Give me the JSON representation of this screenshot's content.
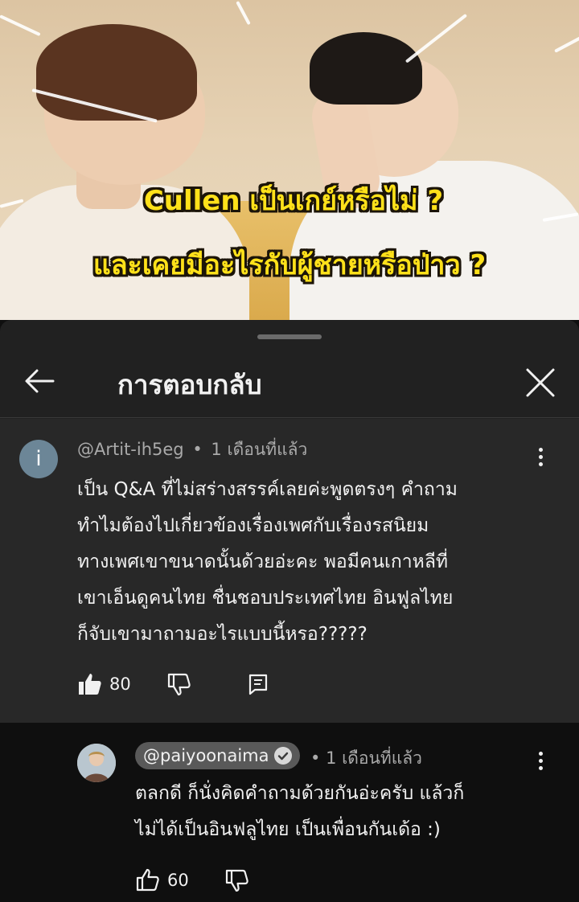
{
  "video": {
    "caption_line1": "Cullen เป็นเกย์หรือไม่ ?",
    "caption_line2": "และเคยมีอะไรกับผู้ชายหรือป่าว ?"
  },
  "sheet": {
    "title": "การตอบกลับ"
  },
  "comment": {
    "author": "@Artit-ih5eg",
    "separator": "•",
    "time": "1 เดือนที่แล้ว",
    "avatar_letter": "i",
    "lines": [
      "เป็น Q&A ที่ไม่สร่างสรรค์เลยค่ะพูดตรงๆ คำถาม",
      "ทำไมต้องไปเกี่ยวข้องเรื่องเพศกับเรื่องรสนิยม",
      "ทางเพศเขาขนาดนั้นด้วยอ่ะคะ พอมีคนเกาหลีที่",
      "เขาเอ็นดูคนไทย ชื่นชอบประเทศไทย อินฟูลไทย",
      "ก็จับเขามาถามอะไรแบบนี้หรอ?????"
    ],
    "likes": "80"
  },
  "reply": {
    "author": "@paiyoonaima",
    "separator": "•",
    "time": "1 เดือนที่แล้ว",
    "lines": [
      "ตลกดี ก็นั่งคิดคำถามด้วยกันอ่ะครับ แล้วก็",
      "ไม่ได้เป็นอินฟลูไทย เป็นเพื่อนกันเด้อ  :)"
    ],
    "likes": "60"
  },
  "colors": {
    "sheet_bg": "#212121",
    "comment_bg": "#282828",
    "reply_bg": "#0f0f0f",
    "caption_yellow": "#ffe11a",
    "meta_gray": "#aaaaaa"
  },
  "icons": {
    "back": "arrow-left-icon",
    "close": "close-icon",
    "more": "more-vert-icon",
    "like_filled": "thumb-up-filled-icon",
    "like_outline": "thumb-up-outline-icon",
    "dislike": "thumb-down-outline-icon",
    "reply": "comment-reply-icon",
    "verified": "verified-check-icon"
  }
}
